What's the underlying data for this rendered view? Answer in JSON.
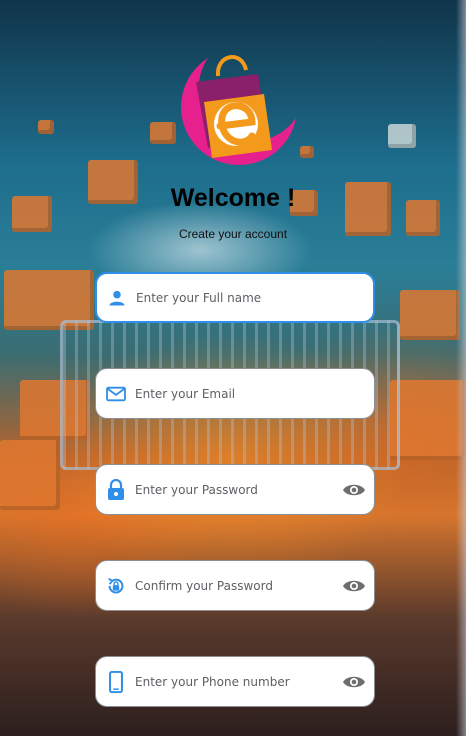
{
  "header": {
    "title": "Welcome !",
    "subtitle": "Create your account"
  },
  "form": {
    "fields": [
      {
        "name": "full-name",
        "placeholder": "Enter your Full name",
        "icon": "person-icon",
        "focused": true
      },
      {
        "name": "email",
        "placeholder": "Enter your Email",
        "icon": "mail-icon"
      },
      {
        "name": "password",
        "placeholder": "Enter your Password",
        "icon": "lock-icon",
        "trailing_icon": "eye-icon"
      },
      {
        "name": "confirm-password",
        "placeholder": "Confirm your Password",
        "icon": "lock-reset-icon",
        "trailing_icon": "eye-icon"
      },
      {
        "name": "phone",
        "placeholder": "Enter your Phone number",
        "icon": "phone-icon",
        "trailing_icon": "eye-icon"
      }
    ]
  },
  "colors": {
    "accent": "#2f8ee8",
    "icon_gray": "#6e6e6e",
    "logo_pink": "#e6208c",
    "logo_orange": "#f39a1d",
    "logo_purple": "#8a1f6a"
  }
}
